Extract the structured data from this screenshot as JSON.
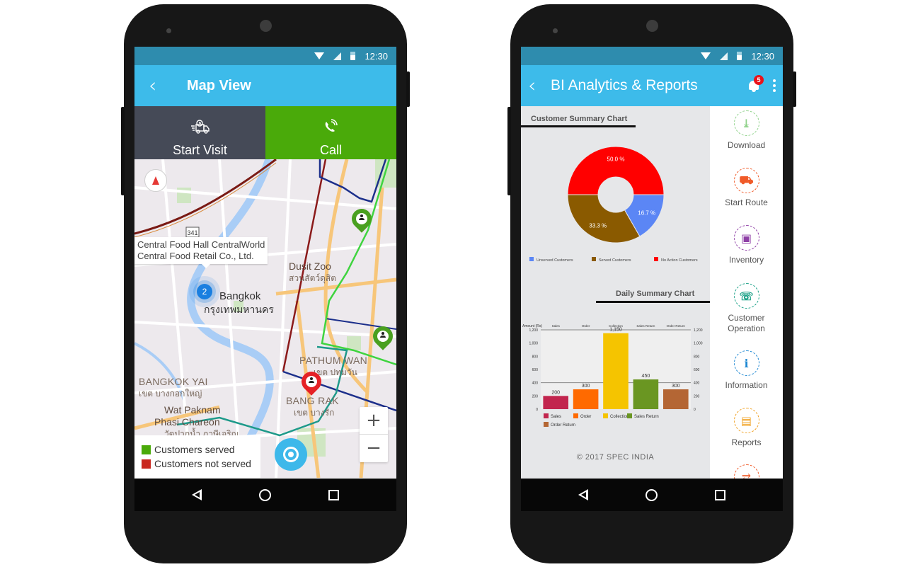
{
  "status_bar": {
    "time": "12:30"
  },
  "map_screen": {
    "title": "Map View",
    "actions": [
      {
        "label": "Start Visit",
        "icon": "delivery-truck-icon"
      },
      {
        "label": "Call",
        "icon": "phone-call-icon"
      }
    ],
    "tooltip": {
      "line1": "Central Food Hall CentralWorld",
      "line2": "Central Food Retail Co., Ltd."
    },
    "cluster_count": "2",
    "road_badge": "341",
    "places": [
      {
        "name": "Bangkok",
        "thai": "กรุงเทพมหานคร"
      },
      {
        "name": "Dusit Zoo",
        "thai": "สวนสัตว์ดุสิต"
      },
      {
        "name": "PATHUM WAN",
        "thai": "เขต ปทุมวัน"
      },
      {
        "name": "BANGKOK YAI",
        "thai": "เขต บางกอกใหญ่"
      },
      {
        "name": "BANG RAK",
        "thai": "เขต บางรัก"
      },
      {
        "name": "Wat Paknam",
        "thai": ""
      },
      {
        "name": "Phasi Chareon",
        "thai": "วัดปากน้ำ ภาษีเจริญ"
      }
    ],
    "legend": [
      {
        "label": "Customers served",
        "color": "#4aaa0a"
      },
      {
        "label": "Customers not served",
        "color": "#c9271e"
      }
    ],
    "zoom_in": "+",
    "zoom_out": "−"
  },
  "bi_screen": {
    "title": "BI Analytics & Reports",
    "notification_count": "5",
    "customer_chart_title": "Customer Summary Chart",
    "daily_chart_title": "Daily Summary Chart",
    "footer": "© 2017 SPEC INDIA",
    "side_menu": [
      {
        "label": "Download",
        "icon": "download-icon",
        "color": "#8fd28a"
      },
      {
        "label": "Start Route",
        "icon": "truck-icon",
        "color": "#f05a28"
      },
      {
        "label": "Inventory",
        "icon": "box-icon",
        "color": "#8e3fa6"
      },
      {
        "label": "Customer Operation",
        "icon": "phone-24-icon",
        "color": "#18a086"
      },
      {
        "label": "Information",
        "icon": "info-icon",
        "color": "#1e88d2"
      },
      {
        "label": "Reports",
        "icon": "report-icon",
        "color": "#f0a020"
      },
      {
        "label": "",
        "icon": "route-icon",
        "color": "#f05a28"
      }
    ]
  },
  "chart_data": [
    {
      "type": "pie",
      "title": "Customer Summary Chart",
      "donut": true,
      "categories": [
        "Unserved Customers",
        "Served Customers",
        "No Action Customers"
      ],
      "values": [
        16.7,
        33.3,
        50.0
      ],
      "labels": [
        "16.7 %",
        "33.3 %",
        "50.0 %"
      ],
      "colors": [
        "#5b86f5",
        "#8a5a00",
        "#ff0000"
      ],
      "legend": "bottom"
    },
    {
      "type": "bar",
      "title": "Daily Summary Chart",
      "categories": [
        "Sales",
        "Order",
        "Collection",
        "Sales Return",
        "Order Return"
      ],
      "values": [
        200,
        300,
        1150,
        450,
        300
      ],
      "value_labels": [
        "200",
        "300",
        "1,150",
        "450",
        "300"
      ],
      "colors": [
        "#c2254e",
        "#ff6a00",
        "#f5c400",
        "#6a9622",
        "#b46634"
      ],
      "ylabel": "Amount (Rs)",
      "y_ticks": [
        "0",
        "200",
        "400",
        "600",
        "800",
        "1,000",
        "1,200"
      ],
      "ylim": [
        0,
        1200
      ],
      "legend": "bottom",
      "grid": false
    }
  ]
}
